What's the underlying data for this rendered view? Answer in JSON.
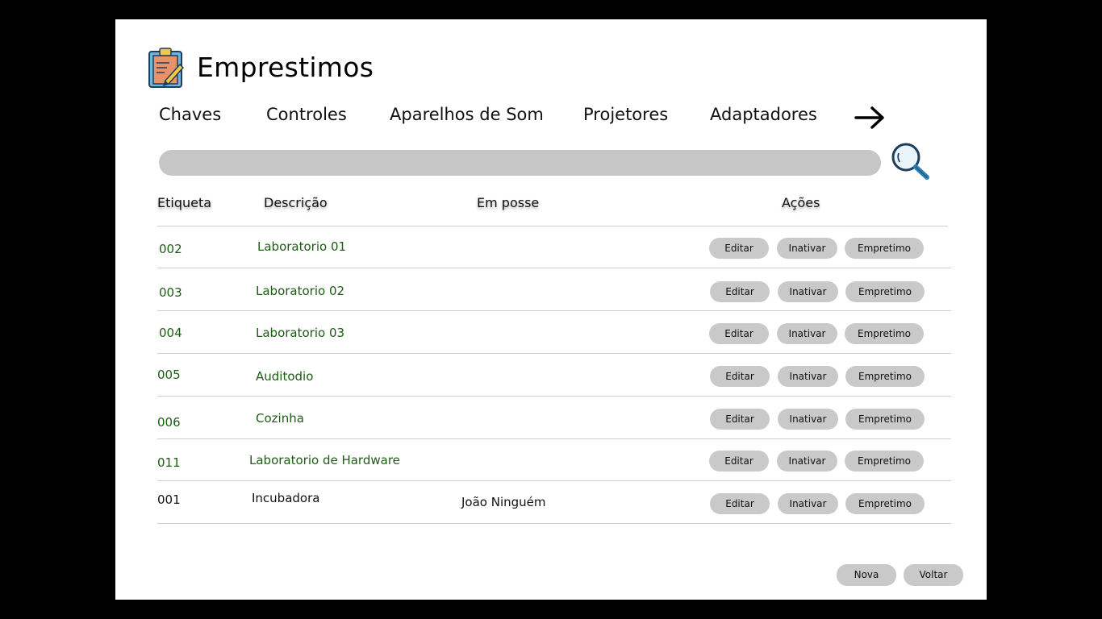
{
  "header": {
    "title": "Emprestimos",
    "icon": "clipboard-pencil-icon"
  },
  "tabs": [
    {
      "label": "Chaves"
    },
    {
      "label": "Controles"
    },
    {
      "label": "Aparelhos de Som"
    },
    {
      "label": "Projetores"
    },
    {
      "label": "Adaptadores"
    }
  ],
  "nav": {
    "next_icon": "arrow-right-icon"
  },
  "search": {
    "value": "",
    "placeholder": "",
    "icon": "magnifier-icon"
  },
  "table": {
    "columns": [
      "Etiqueta",
      "Descrição",
      "Em posse",
      "Ações"
    ],
    "rows": [
      {
        "etiqueta": "002",
        "descricao": "Laboratorio 01",
        "em_posse": "",
        "available": true
      },
      {
        "etiqueta": "003",
        "descricao": "Laboratorio 02",
        "em_posse": "",
        "available": true
      },
      {
        "etiqueta": "004",
        "descricao": "Laboratorio 03",
        "em_posse": "",
        "available": true
      },
      {
        "etiqueta": "005",
        "descricao": "Auditodio",
        "em_posse": "",
        "available": true
      },
      {
        "etiqueta": "006",
        "descricao": "Cozinha",
        "em_posse": "",
        "available": true
      },
      {
        "etiqueta": "011",
        "descricao": "Laboratorio de Hardware",
        "em_posse": "",
        "available": true
      },
      {
        "etiqueta": "001",
        "descricao": "Incubadora",
        "em_posse": "João Ninguém",
        "available": false
      }
    ],
    "actions": {
      "edit": "Editar",
      "inactivate": "Inativar",
      "loan": "Empretimo"
    }
  },
  "footer": {
    "new_label": "Nova",
    "back_label": "Voltar"
  },
  "colors": {
    "available_text": "#1d5c14",
    "button_bg": "#c9c9c9",
    "search_bg": "#c6c6c6"
  }
}
